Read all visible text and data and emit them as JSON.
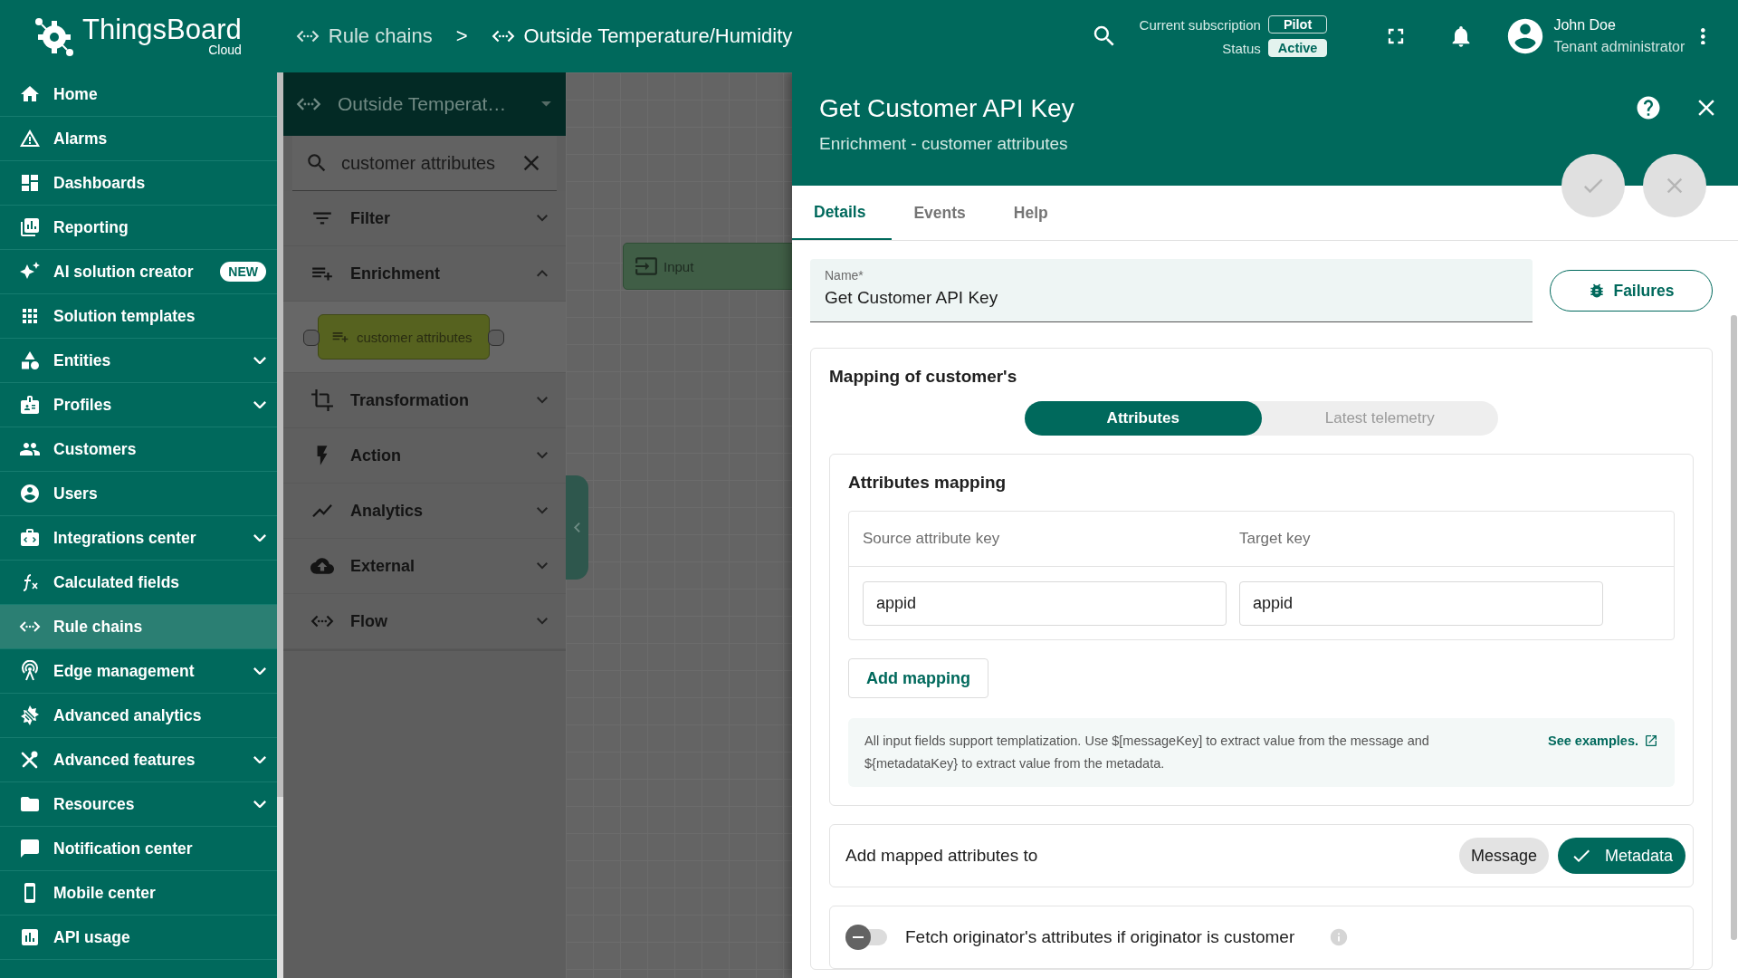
{
  "topbar": {
    "logo_name": "ThingsBoard",
    "logo_sub": "Cloud",
    "breadcrumbs": [
      {
        "label": "Rule chains"
      },
      {
        "label": "Outside Temperature/Humidity"
      }
    ],
    "separator": ">",
    "subscription_label": "Current subscription",
    "subscription_value": "Pilot",
    "status_label": "Status",
    "status_value": "Active",
    "user_name": "John Doe",
    "user_role": "Tenant administrator"
  },
  "sidebar": {
    "items": [
      {
        "label": "Home",
        "selected": false,
        "expandable": false
      },
      {
        "label": "Alarms",
        "selected": false,
        "expandable": false
      },
      {
        "label": "Dashboards",
        "selected": false,
        "expandable": false
      },
      {
        "label": "Reporting",
        "selected": false,
        "expandable": false
      },
      {
        "label": "AI solution creator",
        "selected": false,
        "expandable": false,
        "badge": "NEW"
      },
      {
        "label": "Solution templates",
        "selected": false,
        "expandable": false
      },
      {
        "label": "Entities",
        "selected": false,
        "expandable": true
      },
      {
        "label": "Profiles",
        "selected": false,
        "expandable": true
      },
      {
        "label": "Customers",
        "selected": false,
        "expandable": false
      },
      {
        "label": "Users",
        "selected": false,
        "expandable": false
      },
      {
        "label": "Integrations center",
        "selected": false,
        "expandable": true
      },
      {
        "label": "Calculated fields",
        "selected": false,
        "expandable": false
      },
      {
        "label": "Rule chains",
        "selected": true,
        "expandable": false
      },
      {
        "label": "Edge management",
        "selected": false,
        "expandable": true
      },
      {
        "label": "Advanced analytics",
        "selected": false,
        "expandable": false
      },
      {
        "label": "Advanced features",
        "selected": false,
        "expandable": true
      },
      {
        "label": "Resources",
        "selected": false,
        "expandable": true
      },
      {
        "label": "Notification center",
        "selected": false,
        "expandable": false
      },
      {
        "label": "Mobile center",
        "selected": false,
        "expandable": false
      },
      {
        "label": "API usage",
        "selected": false,
        "expandable": false
      }
    ]
  },
  "node_library": {
    "chain_name": "Outside Temperat…",
    "search_value": "customer attributes",
    "categories": [
      {
        "label": "Filter",
        "expanded": false
      },
      {
        "label": "Enrichment",
        "expanded": true,
        "nodes": [
          {
            "label": "customer attributes"
          }
        ]
      },
      {
        "label": "Transformation",
        "expanded": false
      },
      {
        "label": "Action",
        "expanded": false
      },
      {
        "label": "Analytics",
        "expanded": false
      },
      {
        "label": "External",
        "expanded": false
      },
      {
        "label": "Flow",
        "expanded": false
      }
    ]
  },
  "canvas": {
    "nodes": [
      {
        "label": "Input"
      }
    ]
  },
  "drawer": {
    "title": "Get Customer API Key",
    "subtitle": "Enrichment - customer attributes",
    "tabs": [
      {
        "label": "Details",
        "selected": true
      },
      {
        "label": "Events",
        "selected": false
      },
      {
        "label": "Help",
        "selected": false
      }
    ],
    "name_field": {
      "label": "Name*",
      "value": "Get Customer API Key"
    },
    "failures_button": "Failures",
    "mapping": {
      "title": "Mapping of customer's",
      "sources": [
        {
          "label": "Attributes",
          "selected": true
        },
        {
          "label": "Latest telemetry",
          "selected": false
        }
      ],
      "attributes_mapping": {
        "title": "Attributes mapping",
        "columns": [
          "Source attribute key",
          "Target key"
        ],
        "rows": [
          [
            "appid",
            "appid"
          ]
        ]
      },
      "add_button": "Add mapping",
      "hint": "All input fields support templatization. Use $[messageKey] to extract value from the message and ${metadataKey} to extract value from the metadata.",
      "hint_link": "See examples.",
      "add_to": {
        "label": "Add mapped attributes to",
        "options": [
          {
            "label": "Message",
            "selected": false
          },
          {
            "label": "Metadata",
            "selected": true
          }
        ]
      },
      "fetch_toggle": {
        "label": "Fetch originator's attributes if originator is customer",
        "on": false
      }
    }
  }
}
